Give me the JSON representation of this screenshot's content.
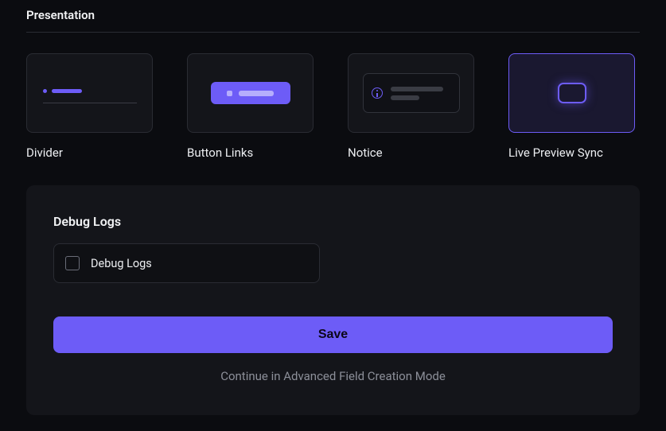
{
  "section": {
    "title": "Presentation"
  },
  "cards": [
    {
      "key": "divider",
      "label": "Divider",
      "selected": false
    },
    {
      "key": "button_links",
      "label": "Button Links",
      "selected": false
    },
    {
      "key": "notice",
      "label": "Notice",
      "selected": false
    },
    {
      "key": "live_preview_sync",
      "label": "Live Preview Sync",
      "selected": true
    }
  ],
  "form": {
    "field_title": "Debug Logs",
    "checkbox": {
      "label": "Debug Logs",
      "checked": false
    },
    "save_label": "Save",
    "advanced_link": "Continue in Advanced Field Creation Mode"
  },
  "colors": {
    "accent": "#6d5cf7",
    "bg": "#0b0c10",
    "panel": "#14151a",
    "border": "#2a2c33",
    "text": "#eceef1",
    "muted": "#8c8f99"
  }
}
